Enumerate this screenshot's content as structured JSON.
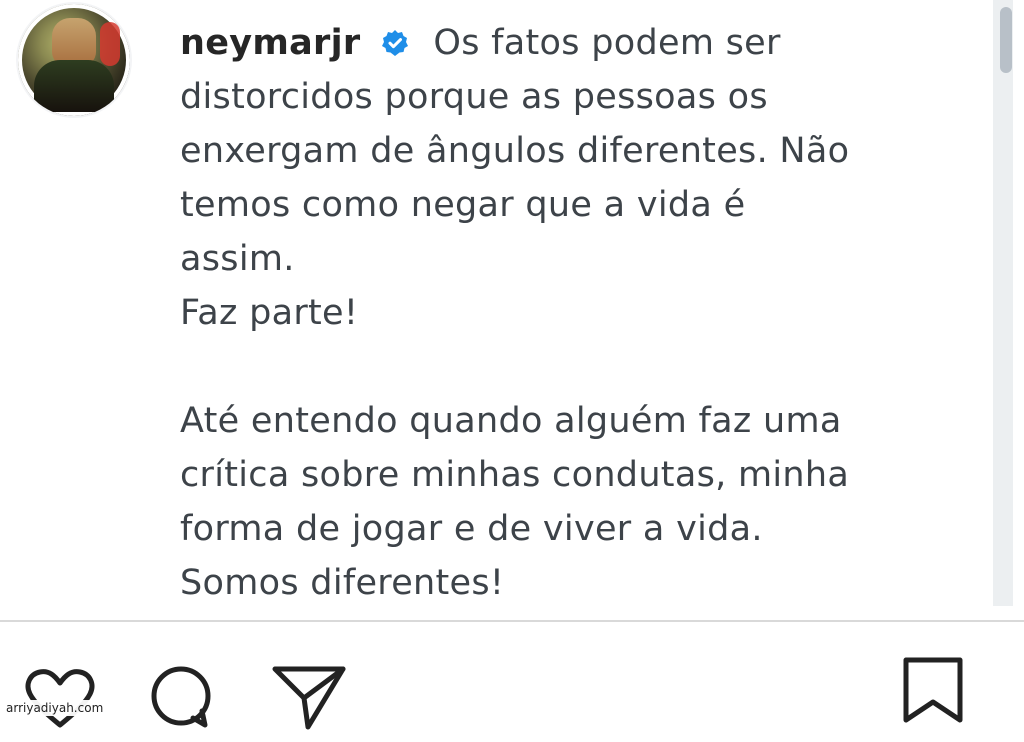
{
  "post": {
    "username": "neymarjr",
    "verified_icon": "verified-badge-icon",
    "caption_lines": [
      "Os fatos podem ser",
      "distorcidos porque as pessoas os",
      "enxergam de ângulos diferentes. Não",
      "temos como negar que a vida é",
      "assim.",
      "Faz parte!",
      "",
      "Até entendo quando alguém faz uma",
      "crítica sobre minhas condutas, minha",
      "forma de jogar e de viver a vida.",
      "Somos diferentes!"
    ]
  },
  "actions": {
    "like_icon": "heart-icon",
    "comment_icon": "comment-icon",
    "share_icon": "send-icon",
    "save_icon": "bookmark-icon"
  },
  "watermark": "arriyadiyah.com",
  "colors": {
    "verified": "#1f8ee8",
    "text": "#3d4349",
    "username": "#262626",
    "divider": "#d9d9d9"
  }
}
